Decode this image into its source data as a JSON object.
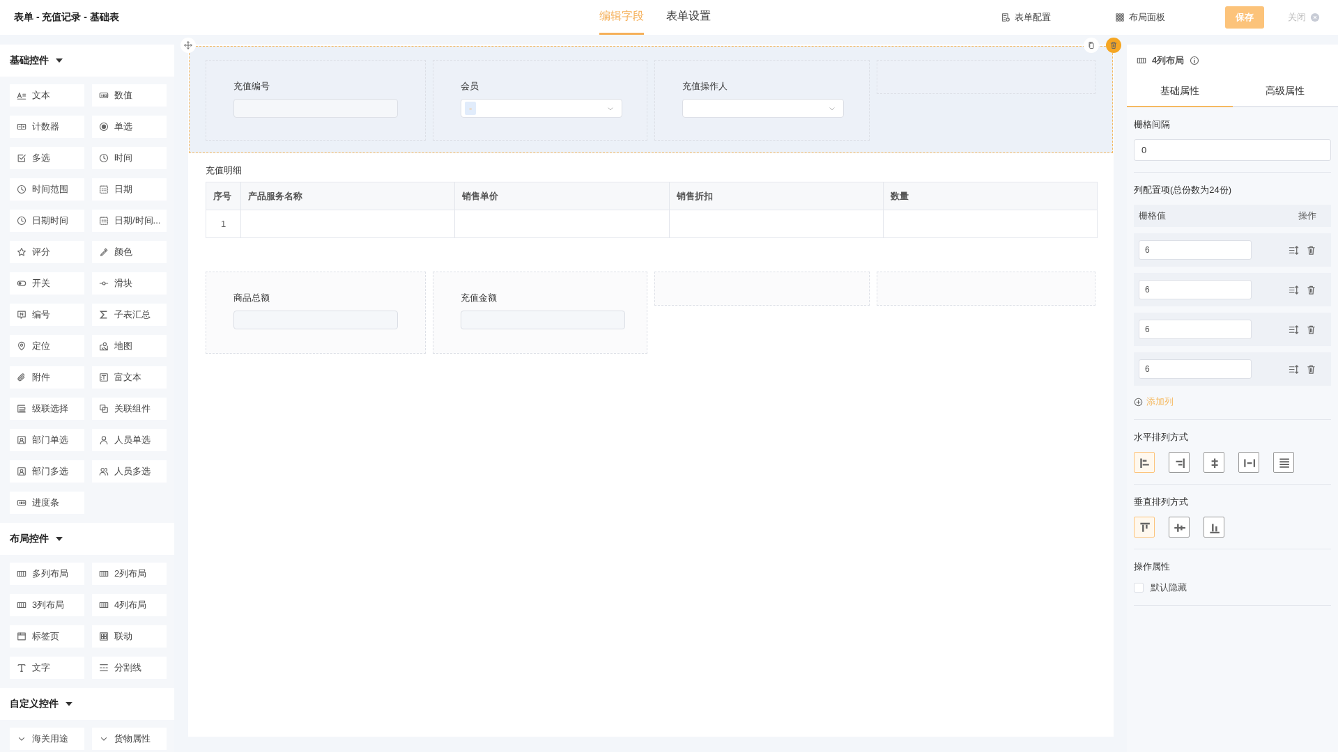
{
  "header": {
    "title": "表单 - 充值记录 - 基础表",
    "tabs": [
      {
        "label": "编辑字段",
        "selected": true
      },
      {
        "label": "表单设置",
        "selected": false
      }
    ],
    "actions": [
      {
        "label": "表单配置",
        "kind": "config"
      },
      {
        "label": "布局面板",
        "kind": "layout"
      }
    ],
    "save": "保存",
    "close": "关闭"
  },
  "sidebar": {
    "sections": [
      {
        "title": "基础控件",
        "expanded": true,
        "items": [
          {
            "label": "文本",
            "kind": "text"
          },
          {
            "label": "数值",
            "kind": "number"
          },
          {
            "label": "计数器",
            "kind": "counter"
          },
          {
            "label": "单选",
            "kind": "radio"
          },
          {
            "label": "多选",
            "kind": "checkbox"
          },
          {
            "label": "时间",
            "kind": "time"
          },
          {
            "label": "时间范围",
            "kind": "time"
          },
          {
            "label": "日期",
            "kind": "date"
          },
          {
            "label": "日期时间",
            "kind": "time"
          },
          {
            "label": "日期/时间...",
            "kind": "date"
          },
          {
            "label": "评分",
            "kind": "rate"
          },
          {
            "label": "颜色",
            "kind": "color"
          },
          {
            "label": "开关",
            "kind": "switch"
          },
          {
            "label": "滑块",
            "kind": "slider"
          },
          {
            "label": "编号",
            "kind": "serial"
          },
          {
            "label": "子表汇总",
            "kind": "sum"
          },
          {
            "label": "定位",
            "kind": "location"
          },
          {
            "label": "地图",
            "kind": "map"
          },
          {
            "label": "附件",
            "kind": "attachment"
          },
          {
            "label": "富文本",
            "kind": "richtext"
          },
          {
            "label": "级联选择",
            "kind": "cascade"
          },
          {
            "label": "关联组件",
            "kind": "relation"
          },
          {
            "label": "部门单选",
            "kind": "dept"
          },
          {
            "label": "人员单选",
            "kind": "user"
          },
          {
            "label": "部门多选",
            "kind": "dept"
          },
          {
            "label": "人员多选",
            "kind": "users"
          },
          {
            "label": "进度条",
            "kind": "number"
          }
        ]
      },
      {
        "title": "布局控件",
        "expanded": true,
        "items": [
          {
            "label": "多列布局",
            "kind": "columns"
          },
          {
            "label": "2列布局",
            "kind": "columns"
          },
          {
            "label": "3列布局",
            "kind": "columns"
          },
          {
            "label": "4列布局",
            "kind": "columns"
          },
          {
            "label": "标签页",
            "kind": "tabs"
          },
          {
            "label": "联动",
            "kind": "linkage"
          },
          {
            "label": "文字",
            "kind": "letter"
          },
          {
            "label": "分割线",
            "kind": "divider"
          }
        ]
      },
      {
        "title": "自定义控件",
        "expanded": true,
        "items": [
          {
            "label": "海关用途",
            "kind": "custom"
          },
          {
            "label": "货物属性",
            "kind": "custom"
          }
        ]
      }
    ]
  },
  "canvas": {
    "top_layout": {
      "selected": true,
      "cells": [
        {
          "kind": "input",
          "label": "充值编号"
        },
        {
          "kind": "select",
          "label": "会员",
          "value": "-"
        },
        {
          "kind": "select",
          "label": "充值操作人"
        },
        {
          "kind": "empty"
        }
      ]
    },
    "subtable": {
      "title": "充值明细",
      "columns": [
        "序号",
        "产品服务名称",
        "销售单价",
        "销售折扣",
        "数量"
      ],
      "rows": [
        {
          "index": "1"
        }
      ]
    },
    "bottom_layout": {
      "selected": false,
      "cells": [
        {
          "kind": "input",
          "label": "商品总额"
        },
        {
          "kind": "input",
          "label": "充值金额"
        },
        {
          "kind": "empty"
        },
        {
          "kind": "empty"
        }
      ]
    }
  },
  "properties": {
    "title": "4列布局",
    "tabs": [
      {
        "label": "基础属性",
        "selected": true
      },
      {
        "label": "高级属性",
        "selected": false
      }
    ],
    "gutter": {
      "label": "栅格间隔",
      "value": "0"
    },
    "columns_config": {
      "title": "列配置项(总份数为24份)",
      "headers": [
        "栅格值",
        "操作"
      ],
      "rows": [
        {
          "value": "6"
        },
        {
          "value": "6"
        },
        {
          "value": "6"
        },
        {
          "value": "6"
        }
      ],
      "add": "添加列"
    },
    "horizontal": {
      "title": "水平排列方式",
      "options": [
        {
          "kind": "start",
          "selected": true
        },
        {
          "kind": "end",
          "selected": false
        },
        {
          "kind": "center",
          "selected": false
        },
        {
          "kind": "between",
          "selected": false
        },
        {
          "kind": "justify",
          "selected": false
        }
      ]
    },
    "vertical": {
      "title": "垂直排列方式",
      "options": [
        {
          "kind": "top",
          "selected": true
        },
        {
          "kind": "middle",
          "selected": false
        },
        {
          "kind": "bottom",
          "selected": false
        }
      ]
    },
    "operation": {
      "title": "操作属性",
      "options": [
        {
          "label": "默认隐藏",
          "checked": false
        }
      ]
    }
  }
}
